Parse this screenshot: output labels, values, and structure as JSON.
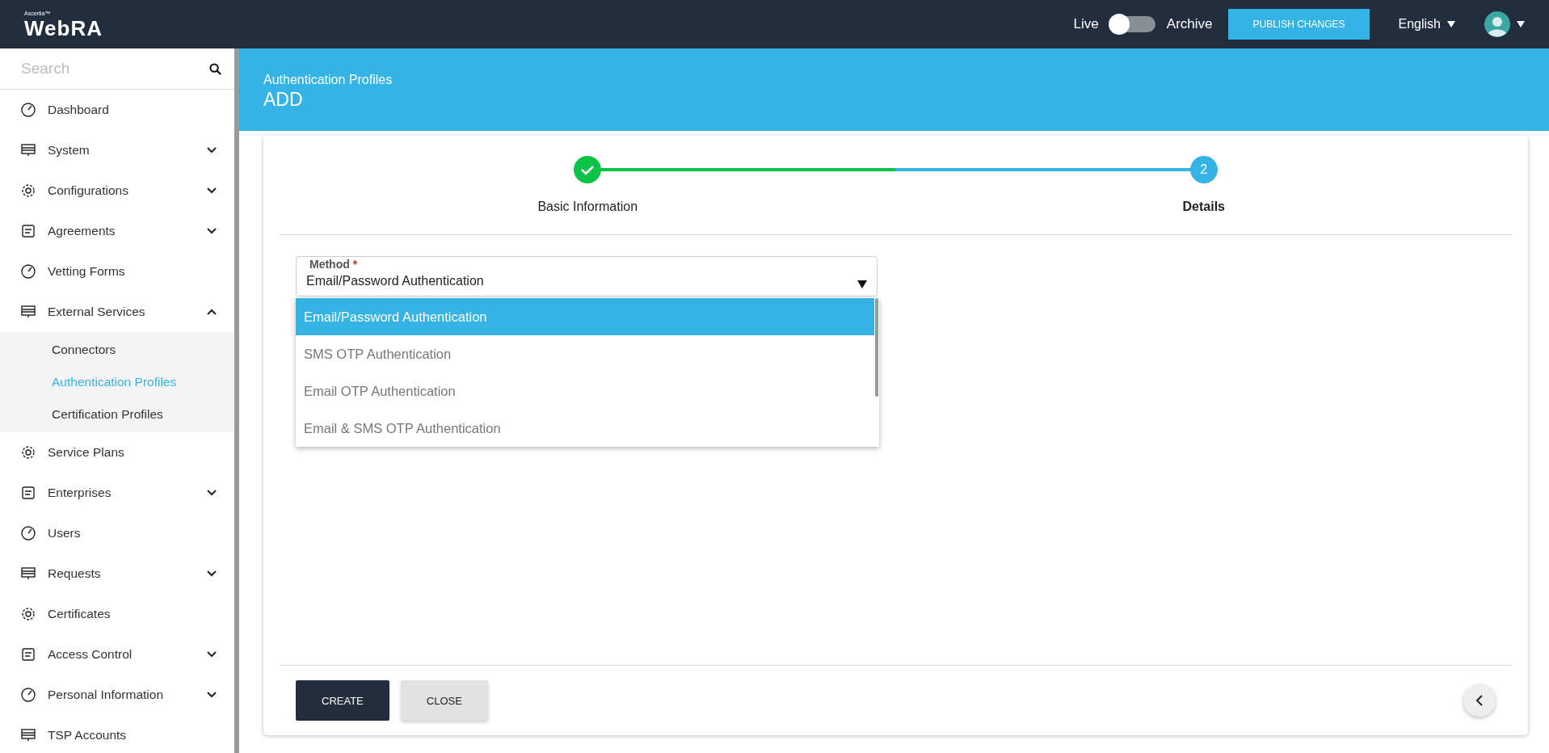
{
  "header": {
    "brand_small": "Ascertia™",
    "brand": "WebRA",
    "toggle": {
      "left_label": "Live",
      "right_label": "Archive",
      "on": false
    },
    "publish_button": "PUBLISH CHANGES",
    "language": "English"
  },
  "sidebar": {
    "search": {
      "placeholder": "Search"
    },
    "items": [
      {
        "label": "Dashboard",
        "kind": "link"
      },
      {
        "label": "System",
        "kind": "group",
        "expanded": false
      },
      {
        "label": "Configurations",
        "kind": "group",
        "expanded": false
      },
      {
        "label": "Agreements",
        "kind": "group",
        "expanded": false
      },
      {
        "label": "Vetting Forms",
        "kind": "link"
      },
      {
        "label": "External Services",
        "kind": "group",
        "expanded": true,
        "children": [
          {
            "label": "Connectors",
            "selected": false
          },
          {
            "label": "Authentication Profiles",
            "selected": true
          },
          {
            "label": "Certification Profiles",
            "selected": false
          }
        ]
      },
      {
        "label": "Service Plans",
        "kind": "link"
      },
      {
        "label": "Enterprises",
        "kind": "group",
        "expanded": false
      },
      {
        "label": "Users",
        "kind": "link"
      },
      {
        "label": "Requests",
        "kind": "group",
        "expanded": false
      },
      {
        "label": "Certificates",
        "kind": "link"
      },
      {
        "label": "Access Control",
        "kind": "group",
        "expanded": false
      },
      {
        "label": "Personal Information",
        "kind": "group",
        "expanded": false
      },
      {
        "label": "TSP Accounts",
        "kind": "link"
      }
    ]
  },
  "page": {
    "breadcrumb": "Authentication Profiles",
    "title": "ADD"
  },
  "stepper": {
    "steps": [
      {
        "label": "Basic Information",
        "completed": true,
        "active": false
      },
      {
        "label": "Details",
        "number": "2",
        "completed": false,
        "active": true
      }
    ]
  },
  "method_field": {
    "label": "Method",
    "required_mark": "*",
    "value": "Email/Password Authentication",
    "expanded": true,
    "options": [
      {
        "label": "Email/Password Authentication",
        "selected": true
      },
      {
        "label": "SMS OTP Authentication",
        "selected": false
      },
      {
        "label": "Email OTP Authentication",
        "selected": false
      },
      {
        "label": "Email & SMS OTP Authentication",
        "selected": false
      }
    ]
  },
  "buttons": [
    {
      "label": "CREATE",
      "kind": "primary"
    },
    {
      "label": "CLOSE",
      "kind": "secondary"
    }
  ]
}
